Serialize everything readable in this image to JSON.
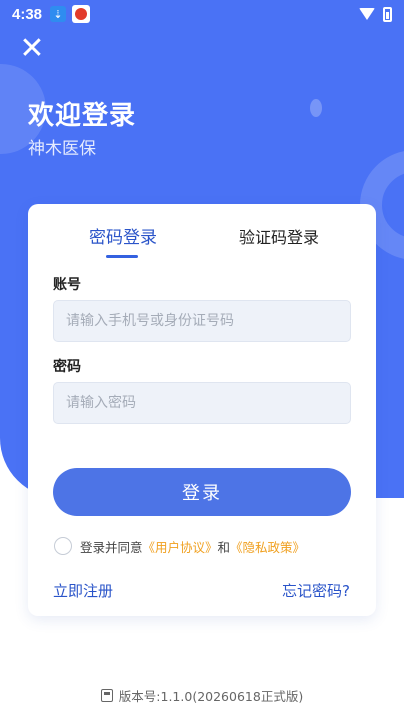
{
  "status_bar": {
    "time": "4:38"
  },
  "header": {
    "close_symbol": "✕",
    "title": "欢迎登录",
    "subtitle": "神木医保"
  },
  "tabs": [
    {
      "label": "密码登录",
      "active": true
    },
    {
      "label": "验证码登录",
      "active": false
    }
  ],
  "form": {
    "account_label": "账号",
    "account_placeholder": "请输入手机号或身份证号码",
    "account_value": "",
    "password_label": "密码",
    "password_placeholder": "请输入密码",
    "password_value": "",
    "login_label": "登录"
  },
  "agreement": {
    "prefix": "登录并同意",
    "user_agreement": "《用户协议》",
    "conjunction": "和",
    "privacy_policy": "《隐私政策》",
    "checked": false
  },
  "links": {
    "register": "立即注册",
    "forgot": "忘记密码?"
  },
  "version": {
    "text": "版本号:1.1.0(20260618正式版)"
  },
  "colors": {
    "primary": "#4a72f5",
    "accent_link": "#2a54c9",
    "agreement_link": "#f0a020",
    "button": "#4d74e6"
  },
  "icons": {
    "download": "download-icon",
    "app": "app-notification-icon",
    "wifi": "wifi-icon",
    "battery": "battery-icon",
    "close": "close-icon",
    "version": "document-icon"
  }
}
